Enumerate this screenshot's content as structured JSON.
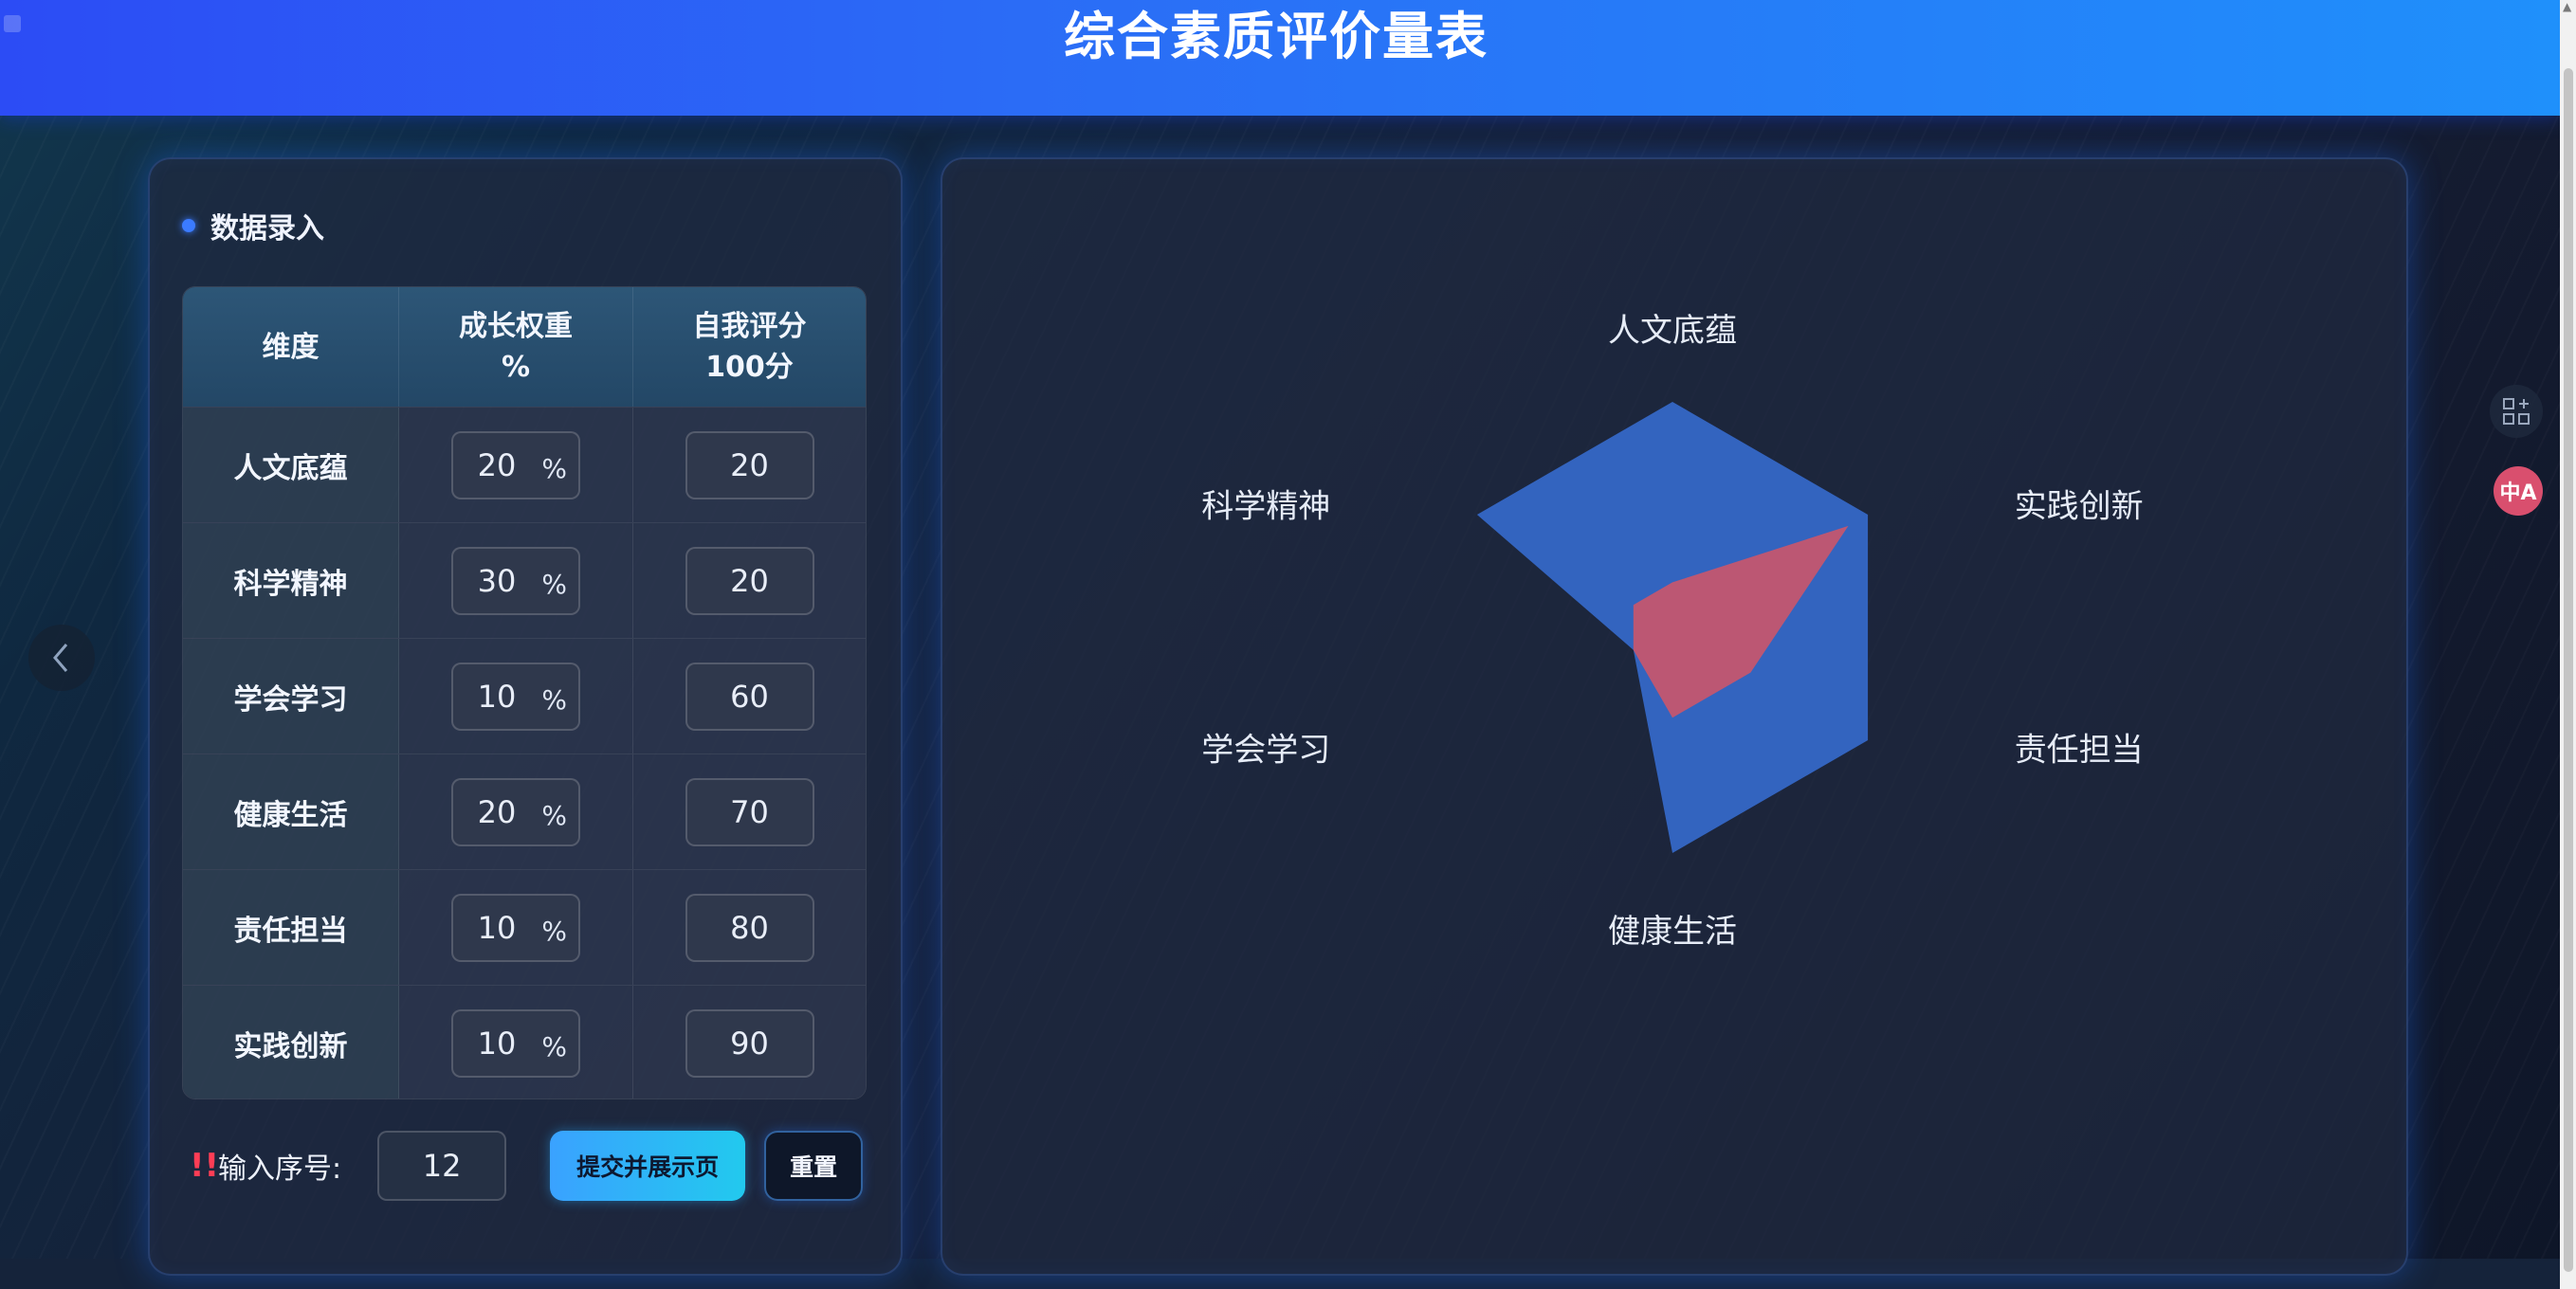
{
  "header": {
    "title": "综合素质评价量表"
  },
  "entry_panel": {
    "title": "数据录入",
    "columns": {
      "dimension": "维度",
      "weight_line1": "成长权重",
      "weight_line2": "%",
      "score_line1": "自我评分",
      "score_line2": "100分"
    },
    "unit": "%",
    "rows": [
      {
        "dimension": "人文底蕴",
        "weight": "20",
        "score": "20"
      },
      {
        "dimension": "科学精神",
        "weight": "30",
        "score": "20"
      },
      {
        "dimension": "学会学习",
        "weight": "10",
        "score": "60"
      },
      {
        "dimension": "健康生活",
        "weight": "20",
        "score": "70"
      },
      {
        "dimension": "责任担当",
        "weight": "10",
        "score": "80"
      },
      {
        "dimension": "实践创新",
        "weight": "10",
        "score": "90"
      }
    ],
    "footer": {
      "warn_icon": "!!",
      "seq_label": "输入序号:",
      "seq_value": "12",
      "submit_label": "提交并展示页",
      "reset_label": "重置"
    }
  },
  "chart_data": {
    "type": "radar",
    "indicators": [
      "人文底蕴",
      "实践创新",
      "责任担当",
      "健康生活",
      "学会学习",
      "科学精神"
    ],
    "max": 100,
    "series": [
      {
        "values": [
          100,
          100,
          100,
          100,
          20,
          100
        ],
        "color": "#3567c6"
      },
      {
        "values": [
          20,
          90,
          40,
          40,
          20,
          20
        ],
        "color": "#c4566f"
      }
    ]
  },
  "icons": {
    "prev": "chevron-left-icon",
    "grid": "grid-add-icon",
    "translate": "translate-icon",
    "translate_glyph": "中A"
  }
}
